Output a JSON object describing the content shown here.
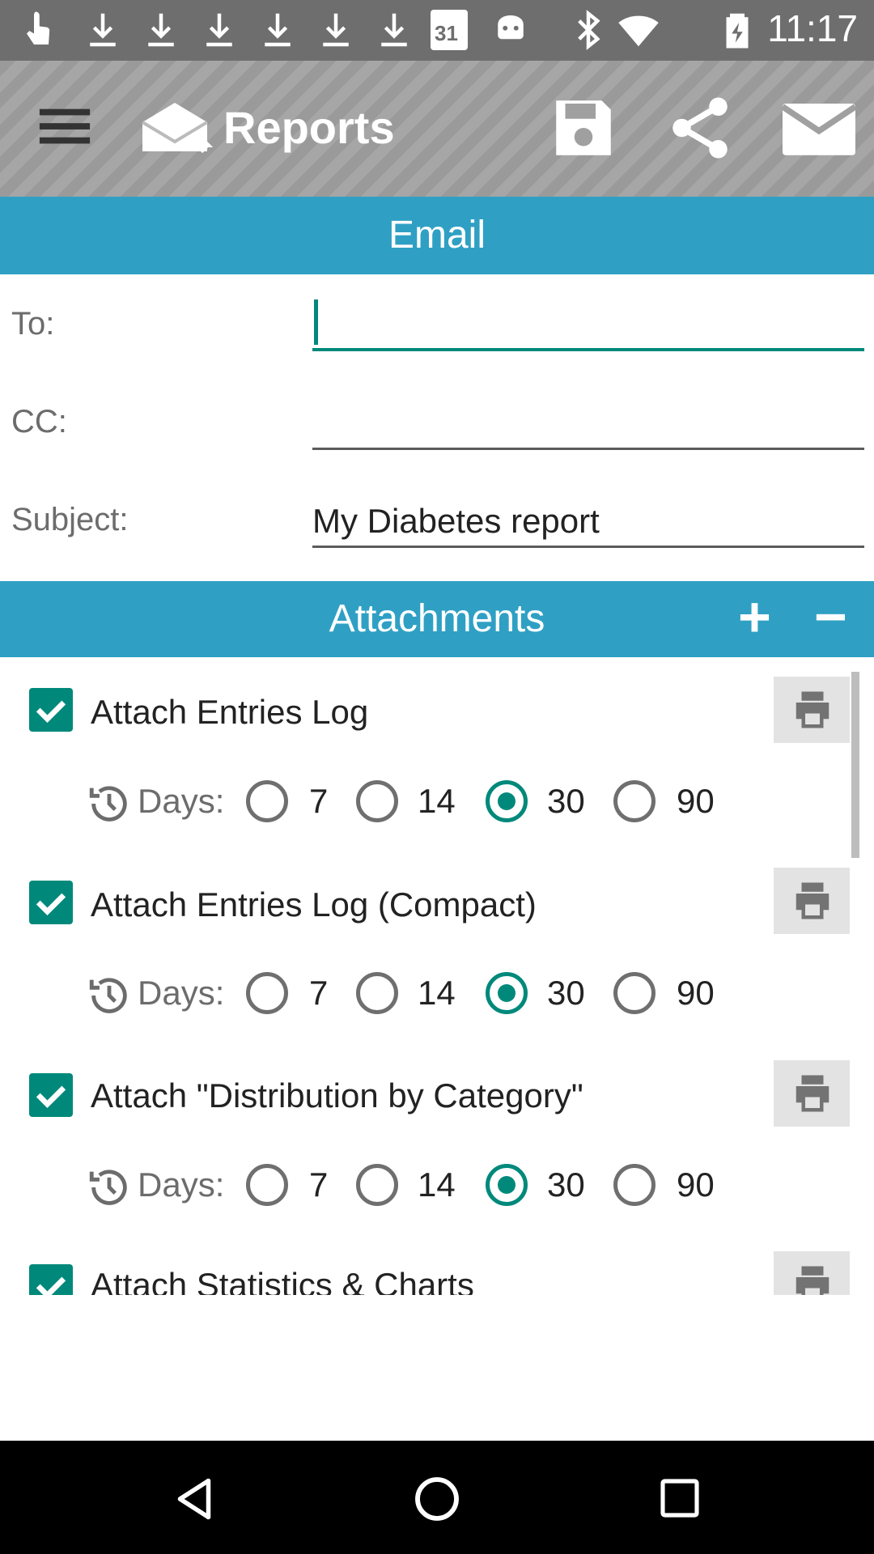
{
  "status_bar": {
    "time": "11:17",
    "icons": [
      "touch-icon",
      "download-icon",
      "download-icon",
      "download-icon",
      "download-icon",
      "download-icon",
      "download-icon",
      "calendar-icon",
      "android-icon",
      "bluetooth-icon",
      "wifi-icon",
      "battery-icon"
    ],
    "calendar_day": "31"
  },
  "toolbar": {
    "title": "Reports",
    "icons": [
      "menu-icon",
      "reports-icon",
      "save-icon",
      "share-icon",
      "email-icon"
    ]
  },
  "email_section": {
    "title": "Email"
  },
  "form": {
    "to_label": "To:",
    "to_value": "",
    "cc_label": "CC:",
    "cc_value": "",
    "subject_label": "Subject:",
    "subject_value": "My Diabetes report"
  },
  "attachments_section": {
    "title": "Attachments",
    "add_label": "+",
    "remove_label": "−"
  },
  "days_label": "Days:",
  "day_options": [
    "7",
    "14",
    "30",
    "90"
  ],
  "attachments": [
    {
      "label": "Attach Entries Log",
      "checked": true,
      "selected_days": "30"
    },
    {
      "label": "Attach Entries Log (Compact)",
      "checked": true,
      "selected_days": "30"
    },
    {
      "label": "Attach \"Distribution by Category\"",
      "checked": true,
      "selected_days": "30"
    },
    {
      "label": "Attach Statistics & Charts",
      "checked": true
    }
  ],
  "colors": {
    "accent": "#00897b",
    "section": "#2fa0c4",
    "toolbar": "#9a9a9a"
  }
}
